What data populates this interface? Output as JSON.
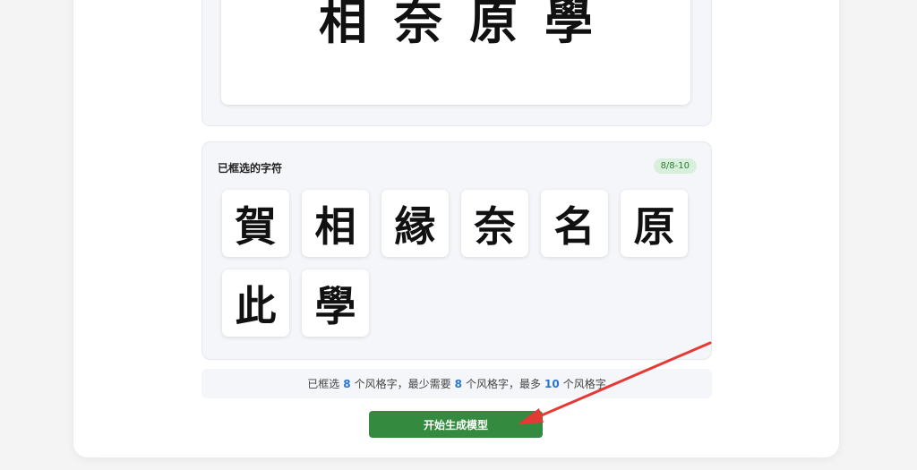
{
  "preview": {
    "characters": [
      "相",
      "奈",
      "原",
      "學"
    ]
  },
  "selected_panel": {
    "title": "已框选的字符",
    "count_badge": "8/8-10",
    "tiles": [
      "賀",
      "相",
      "縁",
      "奈",
      "名",
      "原",
      "此",
      "學"
    ]
  },
  "status": {
    "prefix": "已框选",
    "selected_count": "8",
    "mid1": "个风格字，最少需要",
    "min_count": "8",
    "mid2": "个风格字，最多",
    "max_count": "10",
    "suffix": "个风格字"
  },
  "actions": {
    "start_label": "开始生成模型"
  },
  "colors": {
    "primary_button": "#348a3f",
    "badge_bg": "#d8efdc",
    "badge_text": "#2e7d32",
    "number_highlight": "#2b74d6",
    "annotation_arrow": "#e53935"
  }
}
